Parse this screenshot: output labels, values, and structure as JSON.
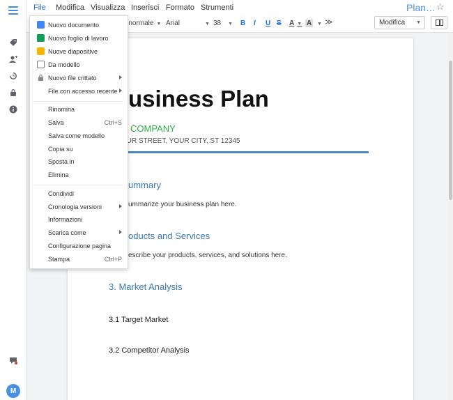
{
  "menubar": {
    "items": [
      "File",
      "Modifica",
      "Visualizza",
      "Inserisci",
      "Formato",
      "Strumenti"
    ],
    "doc_title": "Plan…"
  },
  "toolbar": {
    "style": "o normale",
    "font": "Arial",
    "size": "38",
    "bold": "B",
    "italic": "I",
    "underline": "U",
    "strike": "S",
    "font_color": "A",
    "highlight": "A",
    "mode": "Modifica"
  },
  "file_menu": {
    "groups": [
      [
        {
          "label": "Nuovo documento",
          "icon": "doc-icon",
          "color": "#4285f4"
        },
        {
          "label": "Nuovo foglio di lavoro",
          "icon": "sheet-icon",
          "color": "#0f9d58"
        },
        {
          "label": "Nuove diapositive",
          "icon": "slides-icon",
          "color": "#f4b400"
        },
        {
          "label": "Da modello",
          "icon": "template-icon",
          "color": "#777777"
        },
        {
          "label": "Nuovo file crittato",
          "icon": "lock-icon",
          "submenu": true
        },
        {
          "label": "File con accesso recente",
          "submenu": true
        }
      ],
      [
        {
          "label": "Rinomina"
        },
        {
          "label": "Salva",
          "shortcut": "Ctrl+S"
        },
        {
          "label": "Salva come modello"
        },
        {
          "label": "Copia su"
        },
        {
          "label": "Sposta in"
        },
        {
          "label": "Elimina"
        }
      ],
      [
        {
          "label": "Condividi"
        },
        {
          "label": "Cronologia versioni",
          "submenu": true
        },
        {
          "label": "Informazioni"
        },
        {
          "label": "Scarica come",
          "submenu": true
        },
        {
          "label": "Configurazione pagina"
        },
        {
          "label": "Stampa",
          "shortcut": "Ctrl+P"
        }
      ]
    ]
  },
  "document": {
    "title": "usiness Plan",
    "company": "R COMPANY",
    "address": "OUR STREET, YOUR CITY, ST 12345",
    "summary_heading": "ummary",
    "summary_text": "ummarize your business plan here.",
    "products_heading": "oducts and Services",
    "products_text": "escribe your products, services, and solutions here.",
    "market_heading": "3. Market Analysis",
    "target_market": "3.1 Target Market",
    "competitor": "3.2 Competitor Analysis"
  },
  "user": {
    "initial": "M"
  },
  "colors": {
    "accent": "#4285f4",
    "company": "#2eaf49",
    "heading": "#3a79b6"
  }
}
